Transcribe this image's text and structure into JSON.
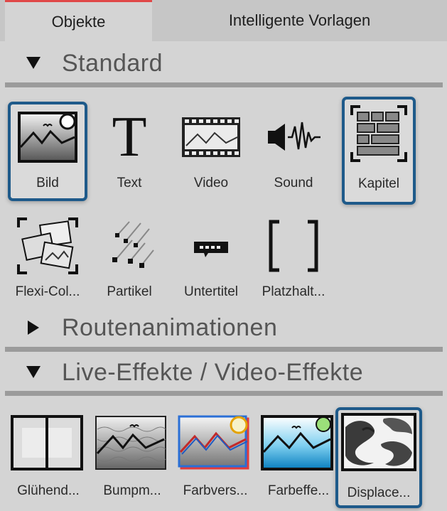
{
  "tabs": {
    "objects": "Objekte",
    "templates": "Intelligente Vorlagen"
  },
  "sections": {
    "standard": {
      "title": "Standard",
      "expanded": true
    },
    "routes": {
      "title": "Routenanimationen",
      "expanded": false
    },
    "live": {
      "title": "Live-Effekte / Video-Effekte",
      "expanded": true
    }
  },
  "standard_items": [
    {
      "label": "Bild",
      "icon": "image-icon",
      "selected": true
    },
    {
      "label": "Text",
      "icon": "text-icon",
      "selected": false
    },
    {
      "label": "Video",
      "icon": "video-icon",
      "selected": false
    },
    {
      "label": "Sound",
      "icon": "sound-icon",
      "selected": false
    },
    {
      "label": "Kapitel",
      "icon": "chapter-icon",
      "selected": true
    },
    {
      "label": "Flexi-Col...",
      "icon": "flexi-collage-icon",
      "selected": false
    },
    {
      "label": "Partikel",
      "icon": "particle-icon",
      "selected": false
    },
    {
      "label": "Untertitel",
      "icon": "subtitle-icon",
      "selected": false
    },
    {
      "label": "Platzhalt...",
      "icon": "placeholder-icon",
      "selected": false
    }
  ],
  "effect_items": [
    {
      "label": "Glühend...",
      "icon": "glow-effect-icon",
      "selected": false
    },
    {
      "label": "Bumpm...",
      "icon": "bumpmap-effect-icon",
      "selected": false
    },
    {
      "label": "Farbvers...",
      "icon": "color-shift-effect-icon",
      "selected": false
    },
    {
      "label": "Farbeffe...",
      "icon": "color-effect-icon",
      "selected": false
    },
    {
      "label": "Displace...",
      "icon": "displace-effect-icon",
      "selected": true
    }
  ],
  "colors": {
    "selection": "#1e5a8a",
    "active_tab_accent": "#e04848"
  }
}
